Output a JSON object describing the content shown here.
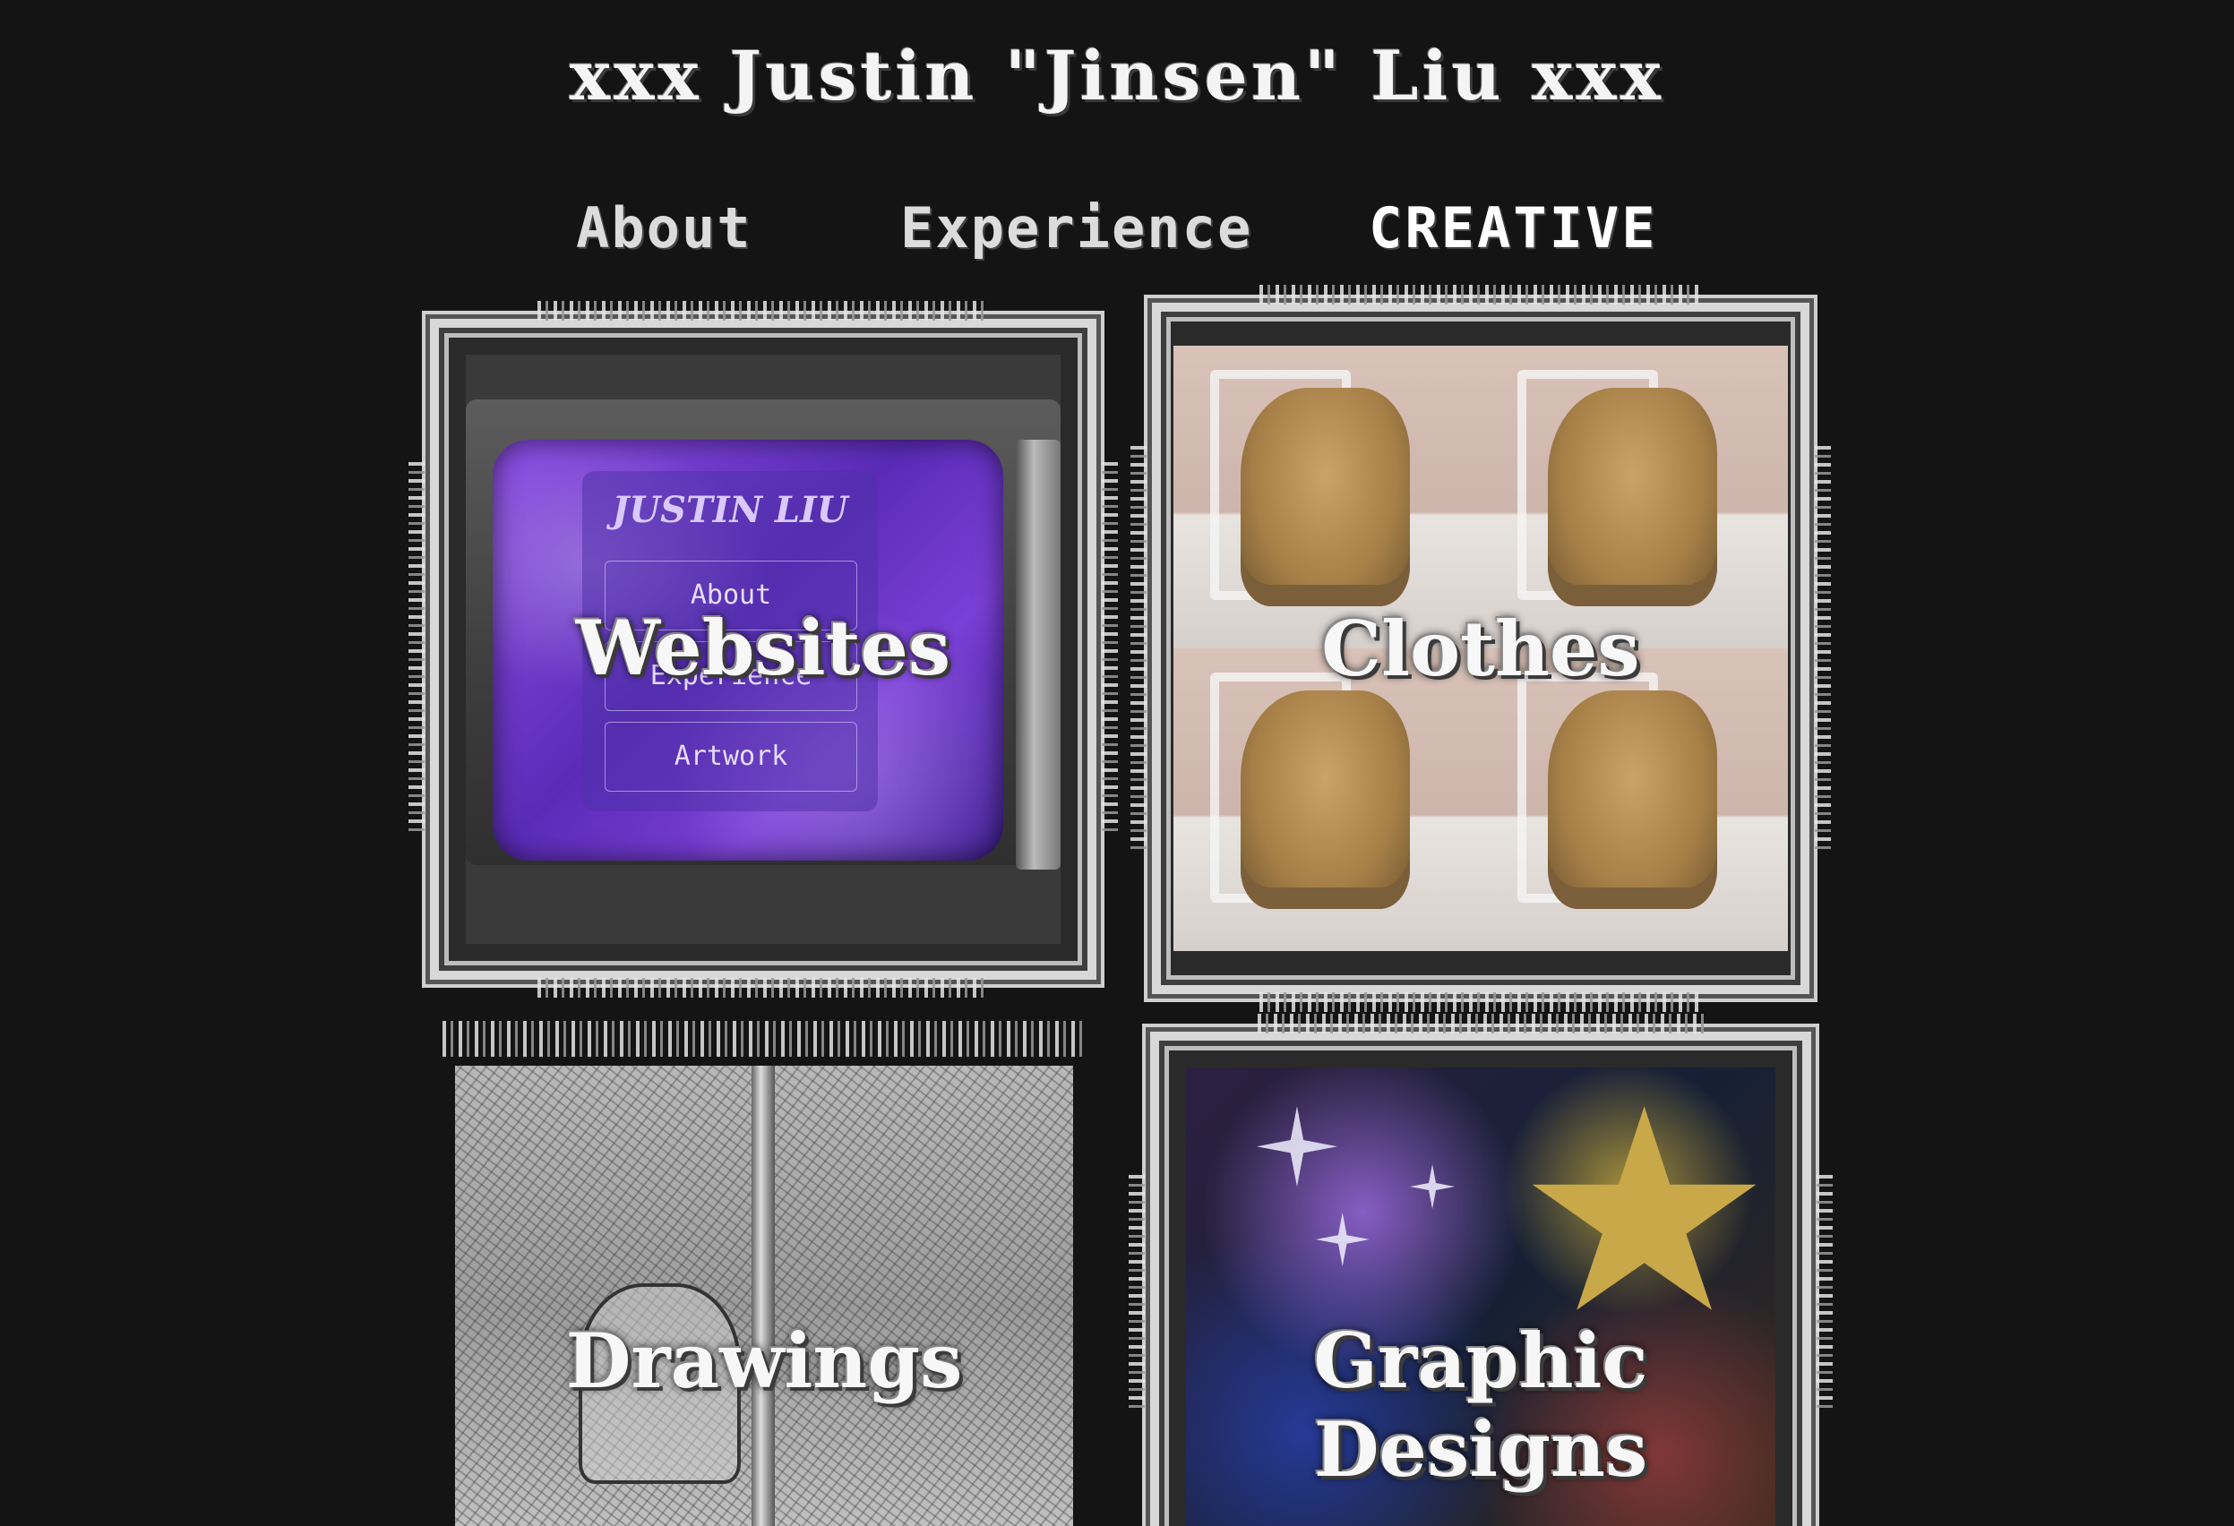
{
  "header": {
    "title": "xxx Justin \"Jinsen\" Liu xxx"
  },
  "nav": {
    "items": [
      {
        "label": "About",
        "active": false
      },
      {
        "label": "Experience",
        "active": false
      },
      {
        "label": "CREATIVE",
        "active": true
      }
    ]
  },
  "cards": [
    {
      "label": "Websites",
      "preview": {
        "name": "JUSTIN LIU",
        "buttons": [
          "About",
          "Experience",
          "Artwork"
        ]
      }
    },
    {
      "label": "Clothes"
    },
    {
      "label": "Drawings"
    },
    {
      "label": "Graphic Designs"
    }
  ],
  "colors": {
    "background": "#141414",
    "text": "#f2f2f2",
    "frame": "#d8d8d8",
    "screen_accent": "#7a3fd6"
  }
}
